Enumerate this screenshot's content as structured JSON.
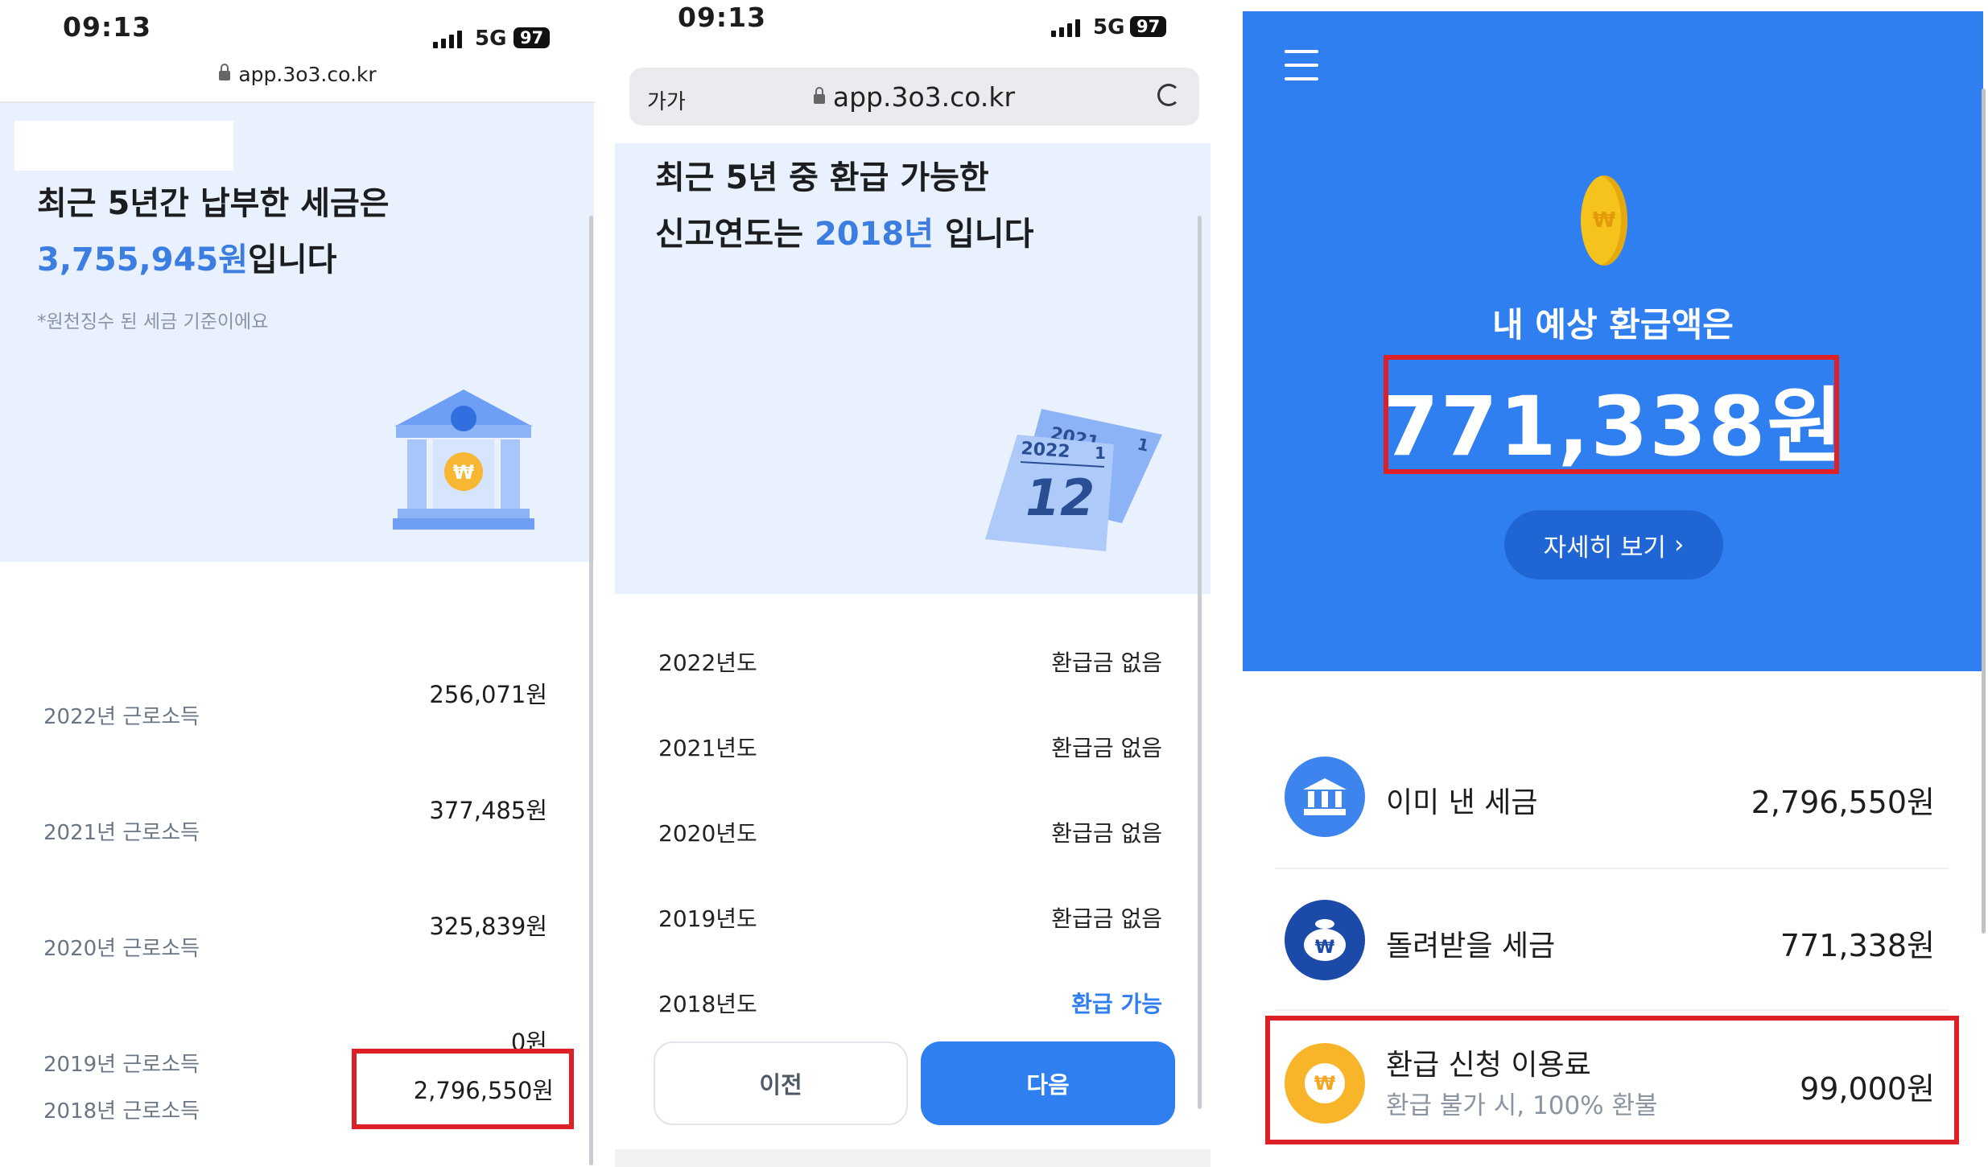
{
  "panel1": {
    "status": {
      "time": "09:13",
      "network": "5G",
      "battery": "97"
    },
    "url": "app.3o3.co.kr",
    "headline_line1": "최근 5년간 납부한 세금은",
    "headline_amount": "3,755,945원",
    "headline_suffix": "입니다",
    "note": "*원천징수 된 세금 기준이에요",
    "rows": [
      {
        "label": "2022년 근로소득",
        "value": "256,071원"
      },
      {
        "label": "2021년 근로소득",
        "value": "377,485원"
      },
      {
        "label": "2020년 근로소득",
        "value": "325,839원"
      },
      {
        "label": "2019년 근로소득",
        "value": "0원"
      },
      {
        "label": "2018년 근로소득",
        "value": "2,796,550원"
      }
    ]
  },
  "panel2": {
    "status": {
      "time": "09:13",
      "network": "5G",
      "battery": "97"
    },
    "aa": "가가",
    "url": "app.3o3.co.kr",
    "headline_line1": "최근 5년 중 환급 가능한",
    "headline_prefix": "신고연도는 ",
    "headline_year": "2018년",
    "headline_suffix": " 입니다",
    "calendar": {
      "back_year": "2021",
      "back_month": "1",
      "front_year": "2022",
      "front_month": "1",
      "front_day": "12"
    },
    "rows": [
      {
        "label": "2022년도",
        "value": "환급금 없음"
      },
      {
        "label": "2021년도",
        "value": "환급금 없음"
      },
      {
        "label": "2020년도",
        "value": "환급금 없음"
      },
      {
        "label": "2019년도",
        "value": "환급금 없음"
      },
      {
        "label": "2018년도",
        "value": "환급 가능"
      }
    ],
    "prev_label": "이전",
    "next_label": "다음",
    "colors": {
      "accent": "#2f7ff0"
    }
  },
  "panel3": {
    "coin_symbol": "₩",
    "subtitle": "내 예상 환급액은",
    "amount": "771,338원",
    "detail_label": "자세히 보기",
    "items": [
      {
        "label": "이미 낸 세금",
        "value": "2,796,550원",
        "icon": "bank-icon"
      },
      {
        "label": "돌려받을 세금",
        "value": "771,338원",
        "icon": "money-bag-icon"
      },
      {
        "label": "환급 신청 이용료",
        "sub": "환급 불가 시, 100% 환불",
        "value": "99,000원",
        "icon": "won-coin-icon"
      }
    ],
    "colors": {
      "hero": "#2f7ff0",
      "highlight": "#dc2026"
    }
  }
}
